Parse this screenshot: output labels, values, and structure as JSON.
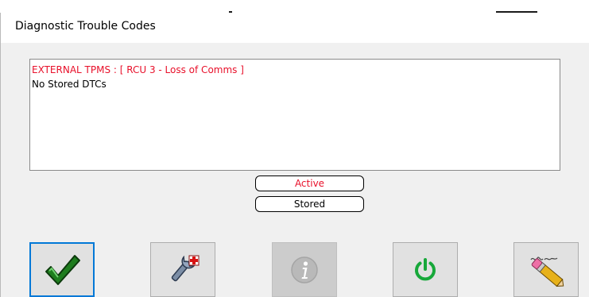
{
  "dialog": {
    "title": "Diagnostic Trouble Codes"
  },
  "dtc_list": {
    "lines": [
      "EXTERNAL TPMS : [ RCU 3 - Loss of Comms ]",
      "No Stored DTCs"
    ]
  },
  "filters": {
    "active_label": "Active",
    "stored_label": "Stored"
  },
  "toolbar": {
    "buttons": [
      {
        "icon": "checkmark-icon",
        "state": "focused"
      },
      {
        "icon": "wrench-add-icon",
        "state": "normal"
      },
      {
        "icon": "info-icon",
        "state": "disabled"
      },
      {
        "icon": "power-icon",
        "state": "normal"
      },
      {
        "icon": "eraser-icon",
        "state": "normal"
      }
    ]
  },
  "colors": {
    "active_red": "#e8102a",
    "panel_bg": "#f0f0f0",
    "focus_blue": "#0078d7",
    "check_green": "#1e7d1e"
  }
}
